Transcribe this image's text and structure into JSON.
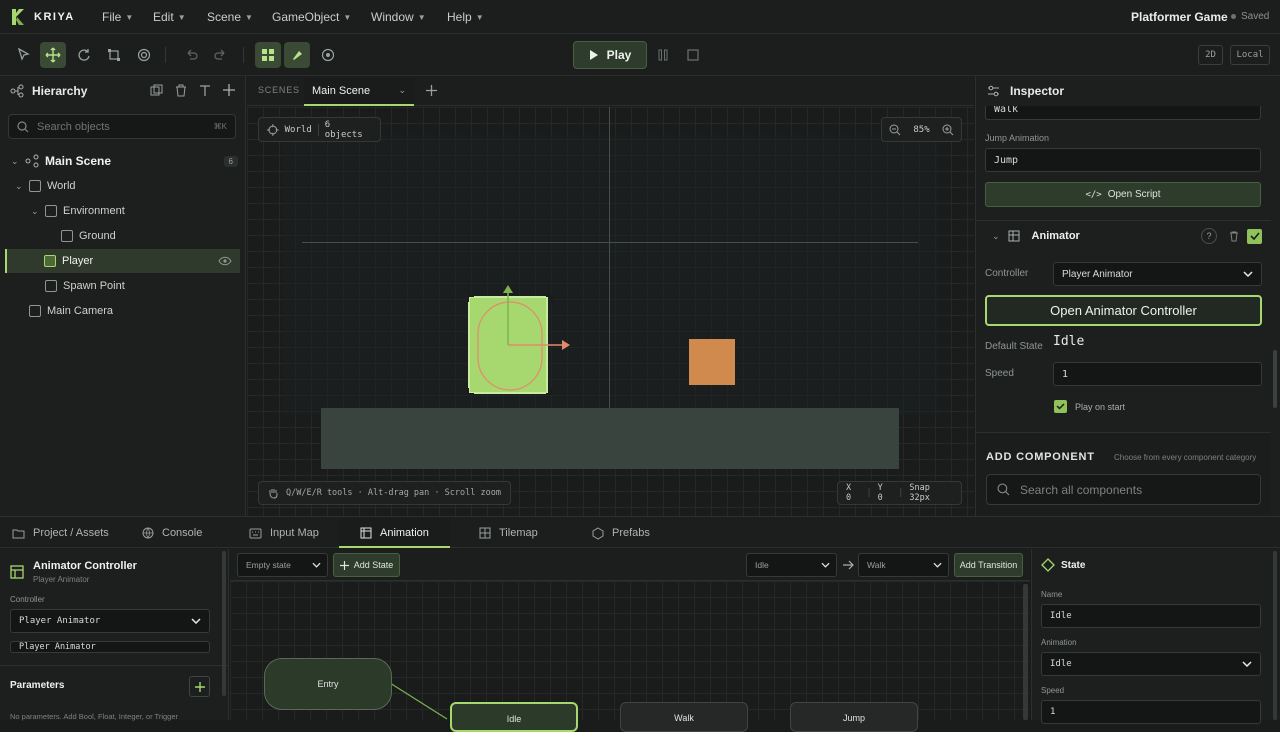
{
  "app": {
    "name": "KRIYA",
    "project": "Platformer Game",
    "save_status": "Saved"
  },
  "menu": [
    "File",
    "Edit",
    "Scene",
    "GameObject",
    "Window",
    "Help"
  ],
  "toolbar": {
    "play_label": "Play",
    "mode_2d": "2D",
    "space": "Local"
  },
  "hierarchy": {
    "title": "Hierarchy",
    "search_placeholder": "Search objects",
    "search_shortcut": "⌘K",
    "root": {
      "label": "Main Scene",
      "count": "6"
    },
    "items": [
      {
        "label": "World"
      },
      {
        "label": "Environment"
      },
      {
        "label": "Ground"
      },
      {
        "label": "Player"
      },
      {
        "label": "Spawn Point"
      },
      {
        "label": "Main Camera"
      }
    ]
  },
  "scene": {
    "scenes_label": "SCENES",
    "tab_label": "Main Scene",
    "world_label": "World",
    "objects_count": "6 objects",
    "zoom": "85%",
    "hint": "Q/W/E/R tools · Alt-drag pan · Scroll zoom",
    "coord_x": "X 0",
    "coord_y": "Y 0",
    "snap": "Snap 32px"
  },
  "inspector": {
    "title": "Inspector",
    "walk_value": "Walk",
    "jump_label": "Jump Animation",
    "jump_value": "Jump",
    "open_script": "Open Script",
    "animator_title": "Animator",
    "controller_label": "Controller",
    "controller_value": "Player Animator",
    "open_controller": "Open Animator Controller",
    "default_state_label": "Default State",
    "default_state_value": "Idle",
    "speed_label": "Speed",
    "speed_value": "1",
    "play_on_start": "Play on start",
    "add_component": "ADD COMPONENT",
    "add_component_hint": "Choose from every component category",
    "component_search_placeholder": "Search all components"
  },
  "bottom_tabs": [
    "Project / Assets",
    "Console",
    "Input Map",
    "Animation",
    "Tilemap",
    "Prefabs"
  ],
  "animation": {
    "controller_title": "Animator Controller",
    "controller_sub": "Player Animator",
    "controller_label": "Controller",
    "controller_value": "Player Animator",
    "controller_name_value": "Player Animator",
    "parameters_title": "Parameters",
    "parameters_empty": "No parameters. Add Bool, Float, Integer, or Trigger",
    "state_select": "Empty state",
    "add_state": "Add State",
    "from_state": "Idle",
    "to_state": "Walk",
    "add_transition": "Add Transition",
    "nodes": {
      "entry": "Entry",
      "idle": "Idle",
      "walk": "Walk",
      "jump": "Jump"
    }
  },
  "state_panel": {
    "title": "State",
    "name_label": "Name",
    "name_value": "Idle",
    "animation_label": "Animation",
    "animation_value": "Idle",
    "speed_label": "Speed",
    "speed_value": "1"
  },
  "colors": {
    "accent": "#a6d86f",
    "player": "#a6d86f",
    "box": "#d08a4e",
    "ground": "#39443f"
  }
}
